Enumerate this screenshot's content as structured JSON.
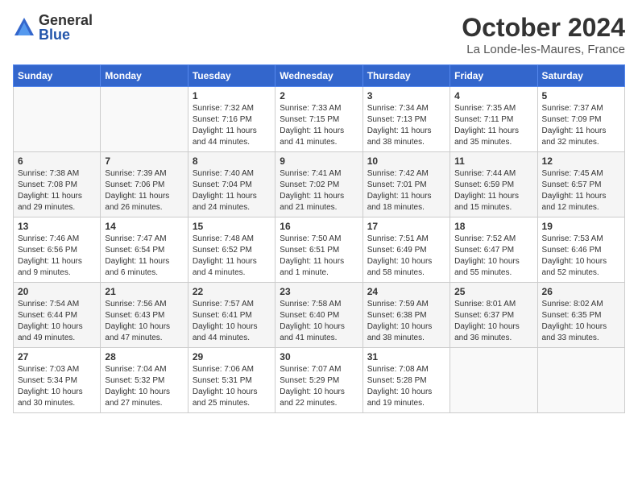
{
  "logo": {
    "general": "General",
    "blue": "Blue"
  },
  "title": "October 2024",
  "location": "La Londe-les-Maures, France",
  "days_of_week": [
    "Sunday",
    "Monday",
    "Tuesday",
    "Wednesday",
    "Thursday",
    "Friday",
    "Saturday"
  ],
  "weeks": [
    [
      null,
      null,
      {
        "day": 1,
        "sunrise": "7:32 AM",
        "sunset": "7:16 PM",
        "daylight": "11 hours and 44 minutes."
      },
      {
        "day": 2,
        "sunrise": "7:33 AM",
        "sunset": "7:15 PM",
        "daylight": "11 hours and 41 minutes."
      },
      {
        "day": 3,
        "sunrise": "7:34 AM",
        "sunset": "7:13 PM",
        "daylight": "11 hours and 38 minutes."
      },
      {
        "day": 4,
        "sunrise": "7:35 AM",
        "sunset": "7:11 PM",
        "daylight": "11 hours and 35 minutes."
      },
      {
        "day": 5,
        "sunrise": "7:37 AM",
        "sunset": "7:09 PM",
        "daylight": "11 hours and 32 minutes."
      }
    ],
    [
      {
        "day": 6,
        "sunrise": "7:38 AM",
        "sunset": "7:08 PM",
        "daylight": "11 hours and 29 minutes."
      },
      {
        "day": 7,
        "sunrise": "7:39 AM",
        "sunset": "7:06 PM",
        "daylight": "11 hours and 26 minutes."
      },
      {
        "day": 8,
        "sunrise": "7:40 AM",
        "sunset": "7:04 PM",
        "daylight": "11 hours and 24 minutes."
      },
      {
        "day": 9,
        "sunrise": "7:41 AM",
        "sunset": "7:02 PM",
        "daylight": "11 hours and 21 minutes."
      },
      {
        "day": 10,
        "sunrise": "7:42 AM",
        "sunset": "7:01 PM",
        "daylight": "11 hours and 18 minutes."
      },
      {
        "day": 11,
        "sunrise": "7:44 AM",
        "sunset": "6:59 PM",
        "daylight": "11 hours and 15 minutes."
      },
      {
        "day": 12,
        "sunrise": "7:45 AM",
        "sunset": "6:57 PM",
        "daylight": "11 hours and 12 minutes."
      }
    ],
    [
      {
        "day": 13,
        "sunrise": "7:46 AM",
        "sunset": "6:56 PM",
        "daylight": "11 hours and 9 minutes."
      },
      {
        "day": 14,
        "sunrise": "7:47 AM",
        "sunset": "6:54 PM",
        "daylight": "11 hours and 6 minutes."
      },
      {
        "day": 15,
        "sunrise": "7:48 AM",
        "sunset": "6:52 PM",
        "daylight": "11 hours and 4 minutes."
      },
      {
        "day": 16,
        "sunrise": "7:50 AM",
        "sunset": "6:51 PM",
        "daylight": "11 hours and 1 minute."
      },
      {
        "day": 17,
        "sunrise": "7:51 AM",
        "sunset": "6:49 PM",
        "daylight": "10 hours and 58 minutes."
      },
      {
        "day": 18,
        "sunrise": "7:52 AM",
        "sunset": "6:47 PM",
        "daylight": "10 hours and 55 minutes."
      },
      {
        "day": 19,
        "sunrise": "7:53 AM",
        "sunset": "6:46 PM",
        "daylight": "10 hours and 52 minutes."
      }
    ],
    [
      {
        "day": 20,
        "sunrise": "7:54 AM",
        "sunset": "6:44 PM",
        "daylight": "10 hours and 49 minutes."
      },
      {
        "day": 21,
        "sunrise": "7:56 AM",
        "sunset": "6:43 PM",
        "daylight": "10 hours and 47 minutes."
      },
      {
        "day": 22,
        "sunrise": "7:57 AM",
        "sunset": "6:41 PM",
        "daylight": "10 hours and 44 minutes."
      },
      {
        "day": 23,
        "sunrise": "7:58 AM",
        "sunset": "6:40 PM",
        "daylight": "10 hours and 41 minutes."
      },
      {
        "day": 24,
        "sunrise": "7:59 AM",
        "sunset": "6:38 PM",
        "daylight": "10 hours and 38 minutes."
      },
      {
        "day": 25,
        "sunrise": "8:01 AM",
        "sunset": "6:37 PM",
        "daylight": "10 hours and 36 minutes."
      },
      {
        "day": 26,
        "sunrise": "8:02 AM",
        "sunset": "6:35 PM",
        "daylight": "10 hours and 33 minutes."
      }
    ],
    [
      {
        "day": 27,
        "sunrise": "7:03 AM",
        "sunset": "5:34 PM",
        "daylight": "10 hours and 30 minutes."
      },
      {
        "day": 28,
        "sunrise": "7:04 AM",
        "sunset": "5:32 PM",
        "daylight": "10 hours and 27 minutes."
      },
      {
        "day": 29,
        "sunrise": "7:06 AM",
        "sunset": "5:31 PM",
        "daylight": "10 hours and 25 minutes."
      },
      {
        "day": 30,
        "sunrise": "7:07 AM",
        "sunset": "5:29 PM",
        "daylight": "10 hours and 22 minutes."
      },
      {
        "day": 31,
        "sunrise": "7:08 AM",
        "sunset": "5:28 PM",
        "daylight": "10 hours and 19 minutes."
      },
      null,
      null
    ]
  ],
  "labels": {
    "sunrise": "Sunrise:",
    "sunset": "Sunset:",
    "daylight": "Daylight:"
  }
}
